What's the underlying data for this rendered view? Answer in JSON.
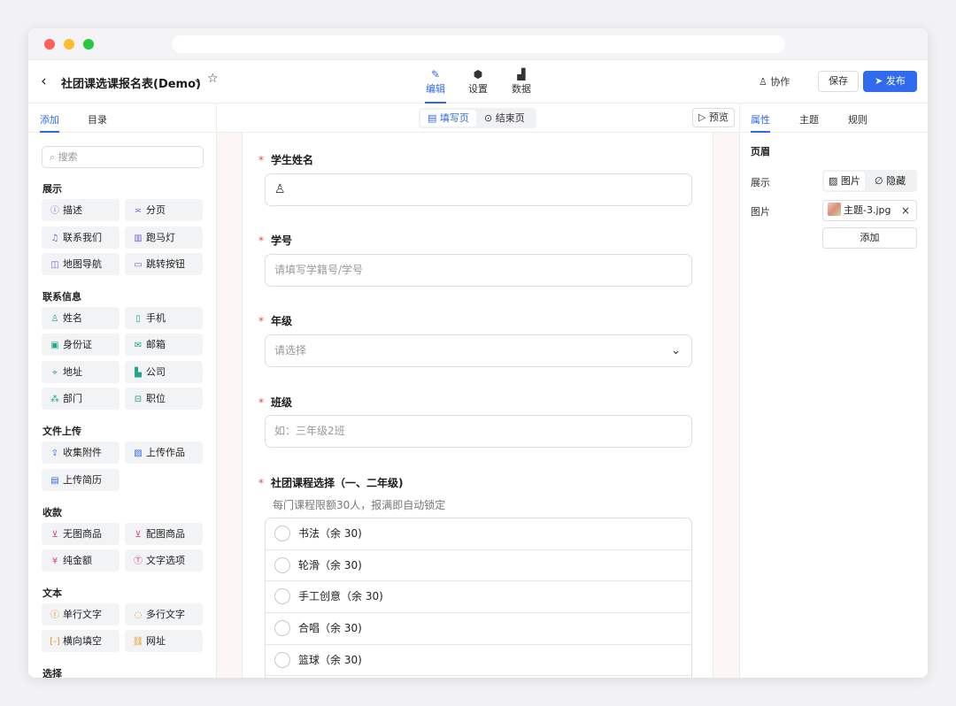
{
  "header": {
    "back_icon": "chevron-left-icon",
    "title": "社团课选课报名表(Demo)",
    "nav_tabs": [
      {
        "label": "编辑",
        "icon": "pen-icon"
      },
      {
        "label": "设置",
        "icon": "gear-icon"
      },
      {
        "label": "数据",
        "icon": "chart-icon"
      }
    ],
    "collab_label": "协作",
    "save_label": "保存",
    "publish_label": "发布"
  },
  "left_panel": {
    "tabs": [
      "添加",
      "目录"
    ],
    "search_placeholder": "搜索",
    "sections": [
      {
        "title": "展示",
        "items": [
          "描述",
          "分页",
          "联系我们",
          "跑马灯",
          "地图导航",
          "跳转按钮"
        ]
      },
      {
        "title": "联系信息",
        "items": [
          "姓名",
          "手机",
          "身份证",
          "邮箱",
          "地址",
          "公司",
          "部门",
          "职位"
        ]
      },
      {
        "title": "文件上传",
        "items": [
          "收集附件",
          "上传作品",
          "上传简历"
        ]
      },
      {
        "title": "收款",
        "items": [
          "无图商品",
          "配图商品",
          "纯金额",
          "文字选项"
        ]
      },
      {
        "title": "文本",
        "items": [
          "单行文字",
          "多行文字",
          "横向填空",
          "网址"
        ]
      },
      {
        "title": "选择",
        "items": []
      }
    ]
  },
  "canvas": {
    "page_tabs": [
      "填写页",
      "结束页"
    ],
    "preview_label": "预览",
    "questions": [
      {
        "label": "学生姓名",
        "placeholder": ""
      },
      {
        "label": "学号",
        "placeholder": "请填写学籍号/学号"
      },
      {
        "label": "年级",
        "placeholder": "请选择"
      },
      {
        "label": "班级",
        "placeholder": "如：三年级2班"
      },
      {
        "label": "社团课程选择（一、二年级)",
        "hint": "每门课程限额30人，报满即自动锁定"
      }
    ],
    "course_options": [
      "书法（余 30)",
      "轮滑（余 30)",
      "手工创意（余 30)",
      "合唱（余 30)",
      "篮球（余 30)"
    ]
  },
  "right_panel": {
    "tabs": [
      "属性",
      "主题",
      "规则"
    ],
    "section_title": "页眉",
    "display_label": "展示",
    "display_options": [
      "图片",
      "隐藏"
    ],
    "image_label": "图片",
    "image_file": "主题-3.jpg",
    "add_label": "添加"
  },
  "colors": {
    "accent": "#2f6bec",
    "required": "#e5484d"
  }
}
